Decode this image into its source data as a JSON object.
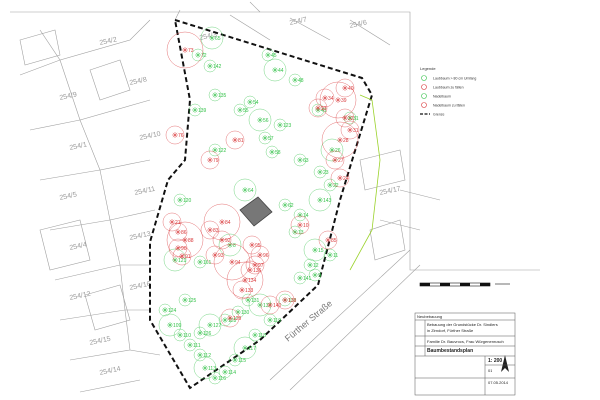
{
  "colors": {
    "tree_keep": "#35c24a",
    "tree_remove": "#d9383a",
    "boundary": "#111111",
    "parcel_line": "#9a9a9a",
    "highlight": "#9ad22a"
  },
  "parcels": [
    "254/7",
    "254/6",
    "254/2",
    "254/3",
    "254/9",
    "254/8",
    "254/1",
    "254/10",
    "254/5",
    "254/11",
    "254/4",
    "254/13",
    "254/12",
    "254/16",
    "254/15",
    "254/14",
    "254/17"
  ],
  "street_label": "Fürther Straße",
  "highlight_label": "",
  "legend": {
    "items": [
      {
        "text": "Laubbaum > 80 cm Umfang",
        "icon": "green-tree-icon"
      },
      {
        "text": "Laubbaum zu fällen",
        "icon": "red-tree-icon"
      },
      {
        "text": "Nadelbaum",
        "icon": "green-tree-icon"
      },
      {
        "text": "Nadelbaum zu fällen",
        "icon": "red-tree-icon"
      },
      {
        "text": "Grenze",
        "icon": "boundary-line-icon"
      }
    ]
  },
  "trees_green": [
    "65",
    "72",
    "142",
    "45",
    "44",
    "48",
    "54",
    "55",
    "56",
    "57",
    "58",
    "31",
    "26",
    "41",
    "23",
    "22",
    "64",
    "62",
    "14",
    "13",
    "15",
    "12",
    "11",
    "9",
    "8",
    "161",
    "141",
    "138",
    "137",
    "131",
    "130",
    "128",
    "127",
    "126",
    "125",
    "124",
    "109",
    "110",
    "111",
    "112",
    "113",
    "116",
    "114",
    "115",
    "117",
    "118",
    "119",
    "120",
    "121",
    "122",
    "123",
    "63",
    "143",
    "139",
    "135"
  ],
  "trees_red": [
    "73",
    "76",
    "79",
    "81",
    "40",
    "39",
    "34",
    "33",
    "32",
    "31",
    "28",
    "27",
    "24",
    "21",
    "86",
    "88",
    "90",
    "91",
    "92",
    "93",
    "94",
    "95",
    "96",
    "97",
    "83",
    "84",
    "85",
    "10",
    "129",
    "133",
    "134",
    "136",
    "139",
    "140"
  ],
  "title_block": {
    "header": "Neubebauung",
    "line1": "Bebauung der Grundstücke Dr. Sindlers",
    "line2": "in Zirndorf, Fürther Straße",
    "client": "Familie Dr. Bauvrocs, Frau Würgenenrusch",
    "plan_title": "Baumbestandsplan",
    "scale": "1: 200",
    "plan_no": "01",
    "date": "07.05.2014"
  }
}
